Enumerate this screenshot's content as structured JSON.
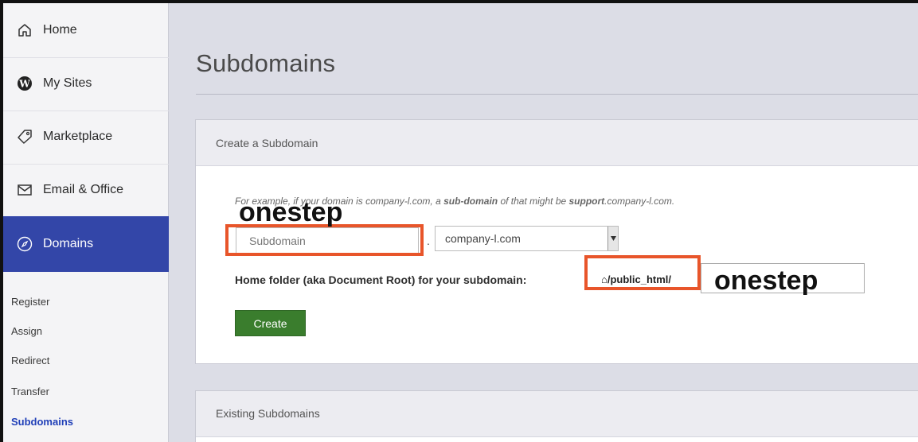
{
  "sidebar": {
    "nav": [
      {
        "label": "Home",
        "icon": "home-icon"
      },
      {
        "label": "My Sites",
        "icon": "wordpress-icon"
      },
      {
        "label": "Marketplace",
        "icon": "tag-icon"
      },
      {
        "label": "Email & Office",
        "icon": "envelope-icon"
      },
      {
        "label": "Domains",
        "icon": "compass-icon",
        "active": true
      }
    ],
    "sub": [
      "Register",
      "Assign",
      "Redirect",
      "Transfer",
      "Subdomains"
    ],
    "current_sub": "Subdomains"
  },
  "main": {
    "title": "Subdomains",
    "create_panel": {
      "heading": "Create a Subdomain",
      "example_pre": "For example, if your domain is company-l.com, a ",
      "example_bold1": "sub-domain",
      "example_mid": " of that might be ",
      "example_bold2": "support",
      "example_post": ".company-l.com.",
      "subdomain_placeholder": "Subdomain",
      "dot": ".",
      "domain_selected": "company-l.com",
      "home_folder_label": "Home folder (aka Document Root) for your subdomain:",
      "folder_prefix": "⌂/public_html/",
      "create_label": "Create"
    },
    "existing_panel": {
      "heading": "Existing Subdomains"
    }
  },
  "annotations": {
    "text1": "onestep",
    "text2": "onestep",
    "highlight_color": "#e8552a"
  },
  "colors": {
    "active_nav": "#3346a8",
    "create_button": "#3a7d2d",
    "current_sub": "#2140b8"
  }
}
